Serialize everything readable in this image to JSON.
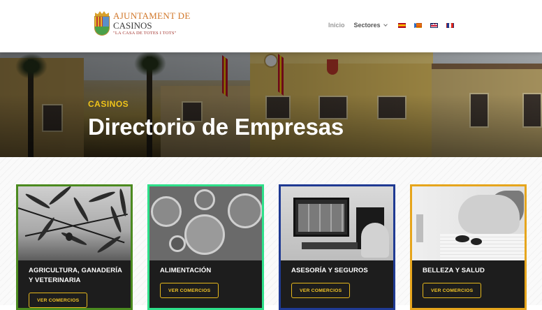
{
  "header": {
    "logo": {
      "line1": "AJUNTAMENT DE",
      "line2": "CASINOS",
      "tagline": "\"LA CASA DE TOTES I TOTS\""
    },
    "nav": {
      "inicio": "Inicio",
      "sectores": "Sectores"
    },
    "languages": [
      "es-flag-icon",
      "va-flag-icon",
      "en-flag-icon",
      "fr-flag-icon"
    ]
  },
  "hero": {
    "kicker": "CASINOS",
    "title": "Directorio de Empresas"
  },
  "colors": {
    "accent": "#f0c419",
    "card_bg": "#1d1d1d",
    "card_borders": [
      "#4b8a1f",
      "#2ee08a",
      "#1f3a93",
      "#e6a51c"
    ]
  },
  "cards": [
    {
      "title": "AGRICULTURA, GANADERÍA Y VETERINARIA",
      "button": "VER COMERCIOS"
    },
    {
      "title": "ALIMENTACIÓN",
      "button": "VER COMERCIOS"
    },
    {
      "title": "ASESORÍA Y SEGUROS",
      "button": "VER COMERCIOS"
    },
    {
      "title": "BELLEZA Y SALUD",
      "button": "VER COMERCIOS"
    }
  ]
}
